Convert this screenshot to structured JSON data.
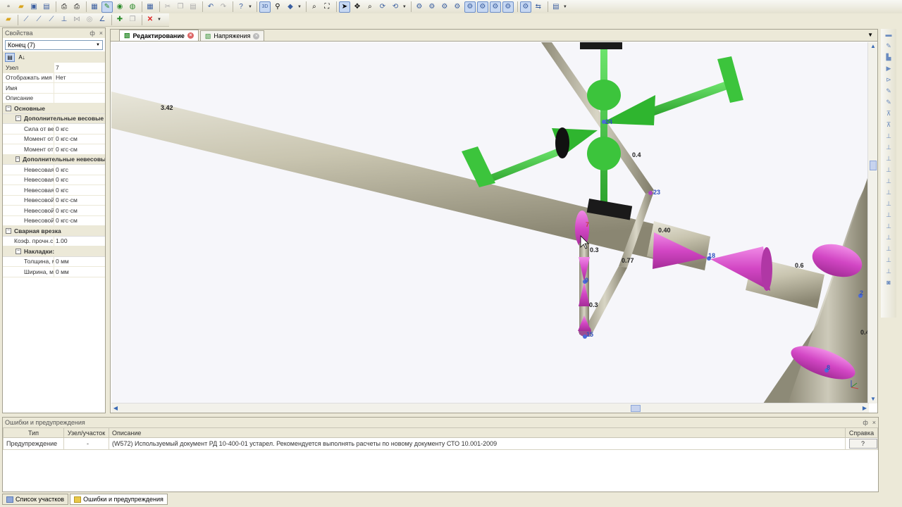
{
  "toolbar": {
    "row1_icons": [
      "new-icon",
      "open-icon",
      "save-icon",
      "save-all-icon",
      "grid-icon",
      "print-icon",
      "preview-icon",
      "table-icon",
      "edit-icon",
      "green-icon",
      "green2-icon",
      "calc-icon",
      "cut-icon",
      "copy-icon",
      "paste-icon",
      "undo-icon",
      "redo-icon",
      "help-icon",
      "3d-icon",
      "binoculars-icon",
      "cube-icon",
      "zoom-window-icon",
      "zoom-extents-icon",
      "select-icon",
      "pan-icon",
      "zoom-icon",
      "rotate-icon",
      "orbit-icon",
      "tool1-icon",
      "tool2-icon",
      "tool3-icon",
      "tool4-icon",
      "tool5-icon",
      "tool6-icon",
      "tool7-icon",
      "tool8-icon",
      "tool9-icon"
    ],
    "view_3d_label": "3D",
    "row2_icons": [
      "add-icon",
      "pipe-icon",
      "elbow-icon",
      "tee-icon",
      "support-icon",
      "valve-icon",
      "node-icon",
      "measure-icon",
      "insert-icon",
      "component-icon",
      "delete-icon"
    ]
  },
  "properties": {
    "title": "Свойства",
    "pin": "ф",
    "close": "×",
    "selected": "Конец (7)",
    "rows": [
      {
        "k": "Узел",
        "v": "7"
      },
      {
        "k": "Отображать имя",
        "v": "Нет"
      },
      {
        "k": "Имя",
        "v": ""
      },
      {
        "k": "Описание",
        "v": ""
      }
    ],
    "cat_main": "Основные",
    "cat_weight": "Дополнительные весовые",
    "weight_rows": [
      {
        "k": "Сила от вес",
        "v": "0 кгс"
      },
      {
        "k": "Момент от в",
        "v": "0 кгс·см"
      },
      {
        "k": "Момент от в",
        "v": "0 кгс·см"
      }
    ],
    "cat_nonweight": "Дополнительные невесовые",
    "nonweight_rows": [
      {
        "k": "Невесовая",
        "v": "0 кгс"
      },
      {
        "k": "Невесовая",
        "v": "0 кгс"
      },
      {
        "k": "Невесовая",
        "v": "0 кгс"
      },
      {
        "k": "Невесовой",
        "v": "0 кгс·см"
      },
      {
        "k": "Невесовой",
        "v": "0 кгс·см"
      },
      {
        "k": "Невесовой",
        "v": "0 кгс·см"
      }
    ],
    "cat_weld": "Сварная врезка",
    "weld_rows": [
      {
        "k": "Коэф. прочн.с",
        "v": "1.00"
      }
    ],
    "cat_pads": "Накладки:",
    "pad_rows": [
      {
        "k": "Толщина, м",
        "v": "0 мм"
      },
      {
        "k": "Ширина, м",
        "v": "0 мм"
      }
    ]
  },
  "doc_tabs": [
    {
      "label": "Редактирование",
      "active": true
    },
    {
      "label": "Напряжения",
      "active": false
    }
  ],
  "model_labels": {
    "l342": "3.42",
    "n24": "24",
    "l04": "0.4",
    "n23": "23",
    "l040": "0.40",
    "n18": "18",
    "l06": "0.6",
    "n7": "7",
    "l03a": "0.3",
    "l077": "0.77",
    "n9": "9",
    "l03b": "0.3",
    "n15": "15",
    "n2": "2",
    "n8": "8",
    "l04b": "0.4"
  },
  "errors": {
    "title": "Ошибки и предупреждения",
    "columns": [
      "Тип",
      "Узел/участок",
      "Описание",
      "Справка"
    ],
    "rows": [
      {
        "type": "Предупреждение",
        "node": "-",
        "desc": "(W572) Используемый документ РД 10-400-01 устарел. Рекомендуется выполнять расчеты по новому документу СТО 10.001-2009",
        "help": "?"
      }
    ]
  },
  "bottom_tabs": [
    {
      "label": "Список участков",
      "active": false
    },
    {
      "label": "Ошибки и предупреждения",
      "active": true
    }
  ]
}
